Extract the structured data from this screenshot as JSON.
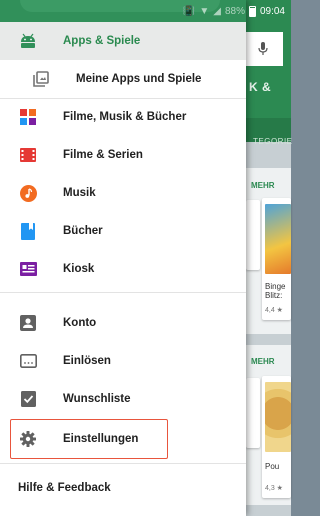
{
  "status_bar": {
    "battery_text": "88%",
    "time": "09:04"
  },
  "background": {
    "tab_text": "K &",
    "section_tab": "TEGORIE",
    "more_1": "MEHR",
    "more_2": "MEHR",
    "card_title_1": "Binge\nBlitz:",
    "card_rating_1": "4,4 ★",
    "card_title_2": "Pou",
    "card_rating_2": "4,3 ★"
  },
  "drawer": {
    "items": [
      {
        "label": "Apps & Spiele",
        "icon": "android-icon",
        "active": true
      },
      {
        "label": "Meine Apps und Spiele",
        "icon": "my-apps-icon"
      },
      {
        "label": "Filme, Musik & Bücher",
        "icon": "entertainment-icon"
      },
      {
        "label": "Filme & Serien",
        "icon": "film-icon"
      },
      {
        "label": "Musik",
        "icon": "music-icon"
      },
      {
        "label": "Bücher",
        "icon": "book-icon"
      },
      {
        "label": "Kiosk",
        "icon": "newsstand-icon"
      },
      {
        "label": "Konto",
        "icon": "account-icon"
      },
      {
        "label": "Einlösen",
        "icon": "redeem-icon"
      },
      {
        "label": "Wunschliste",
        "icon": "wishlist-icon"
      },
      {
        "label": "Einstellungen",
        "icon": "gear-icon"
      }
    ],
    "footer": {
      "help_label": "Hilfe & Feedback"
    }
  },
  "colors": {
    "accent_green": "#31905a",
    "highlight_red": "#e8553d",
    "film_red": "#e53935",
    "music_orange": "#f26b21",
    "book_blue": "#2196f3",
    "kiosk_purple": "#7b1fa2"
  }
}
